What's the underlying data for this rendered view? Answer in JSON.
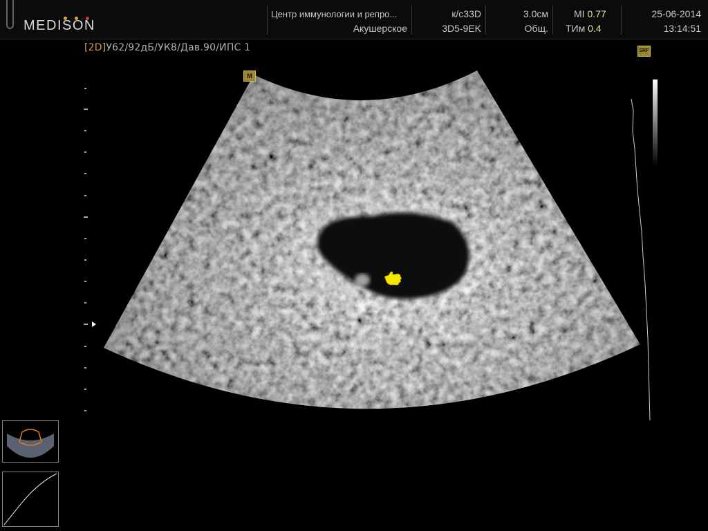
{
  "brand": {
    "name": "MEDISON",
    "dot_colors": [
      "#e1a63a",
      "#e1a63a",
      "#d23a2a"
    ]
  },
  "header": {
    "facility": "Центр иммунологии и репро...",
    "exam_type": "Акушерское",
    "preset": "к/с33D",
    "probe": "3D5-9EK",
    "depth": "3.0см",
    "app_mode": "Общ.",
    "mi_label": "MI",
    "mi_value": "0.77",
    "ti_label": "ТИм",
    "ti_value": "0.4",
    "date": "25-06-2014",
    "time": "13:14:51"
  },
  "scan_params": {
    "mode_tag": "[2D]",
    "settings": "У62/92дБ/УК8/Дав.90/ИПС 1"
  },
  "badges": {
    "harmonic": "M",
    "srf": "SRF"
  },
  "colors": {
    "accent_orange": "#c8a050",
    "cursor_yellow": "#f5e600",
    "header_text": "#c6c6c6"
  },
  "icons": {
    "cursor": "hand-pointer-icon",
    "probe_thumb": "probe-orientation-icon",
    "gain_curve": "gain-curve-icon"
  }
}
